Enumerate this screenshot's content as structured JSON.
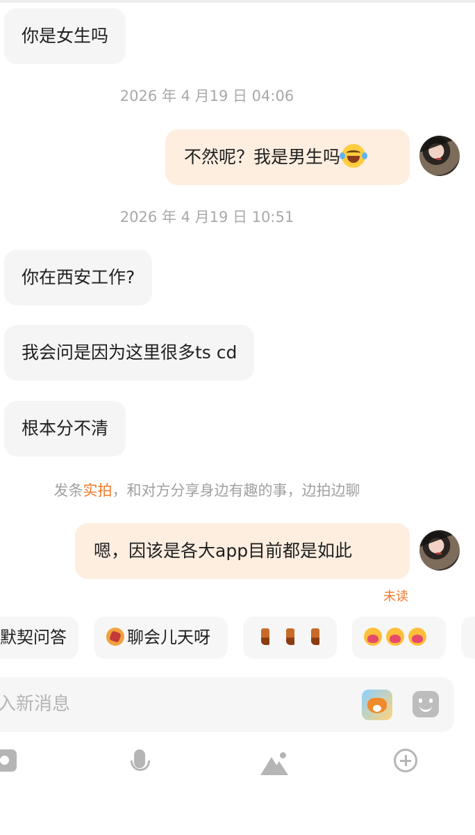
{
  "messages": [
    {
      "side": "in",
      "text": "你是女生吗"
    },
    {
      "timestamp": "2026 年 4 月19 日 04:06"
    },
    {
      "side": "out",
      "text": "不然呢？我是男生吗",
      "emoji": "face-with-tears-of-joy-icon"
    },
    {
      "timestamp": "2026 年 4 月19 日 10:51"
    },
    {
      "side": "in",
      "text": "你在西安工作?"
    },
    {
      "side": "in",
      "text": "我会问是因为这里很多ts cd"
    },
    {
      "side": "in",
      "text": "根本分不清"
    },
    {
      "side": "out",
      "text": "嗯，因该是各大app目前都是如此"
    }
  ],
  "hint": {
    "prefix": "发条",
    "accent": "实拍",
    "suffix": "，和对方分享身边有趣的事，边拍边聊"
  },
  "status": {
    "unread": "未读"
  },
  "quick_replies": [
    {
      "label": "默契问答"
    },
    {
      "label": "聊会儿天呀",
      "icon": "phone-chat-icon"
    },
    {
      "label": "",
      "icon": "boots-icon"
    },
    {
      "label": "",
      "icon": "hug-icon"
    }
  ],
  "input": {
    "placeholder": "入新消息"
  },
  "colors": {
    "accent": "#ef7a2d",
    "outgoing_bubble": "#fdeee0",
    "incoming_bubble": "#f5f5f5"
  },
  "toolbar": {
    "icons": [
      "camera-icon",
      "microphone-icon",
      "image-icon",
      "add-icon"
    ]
  }
}
